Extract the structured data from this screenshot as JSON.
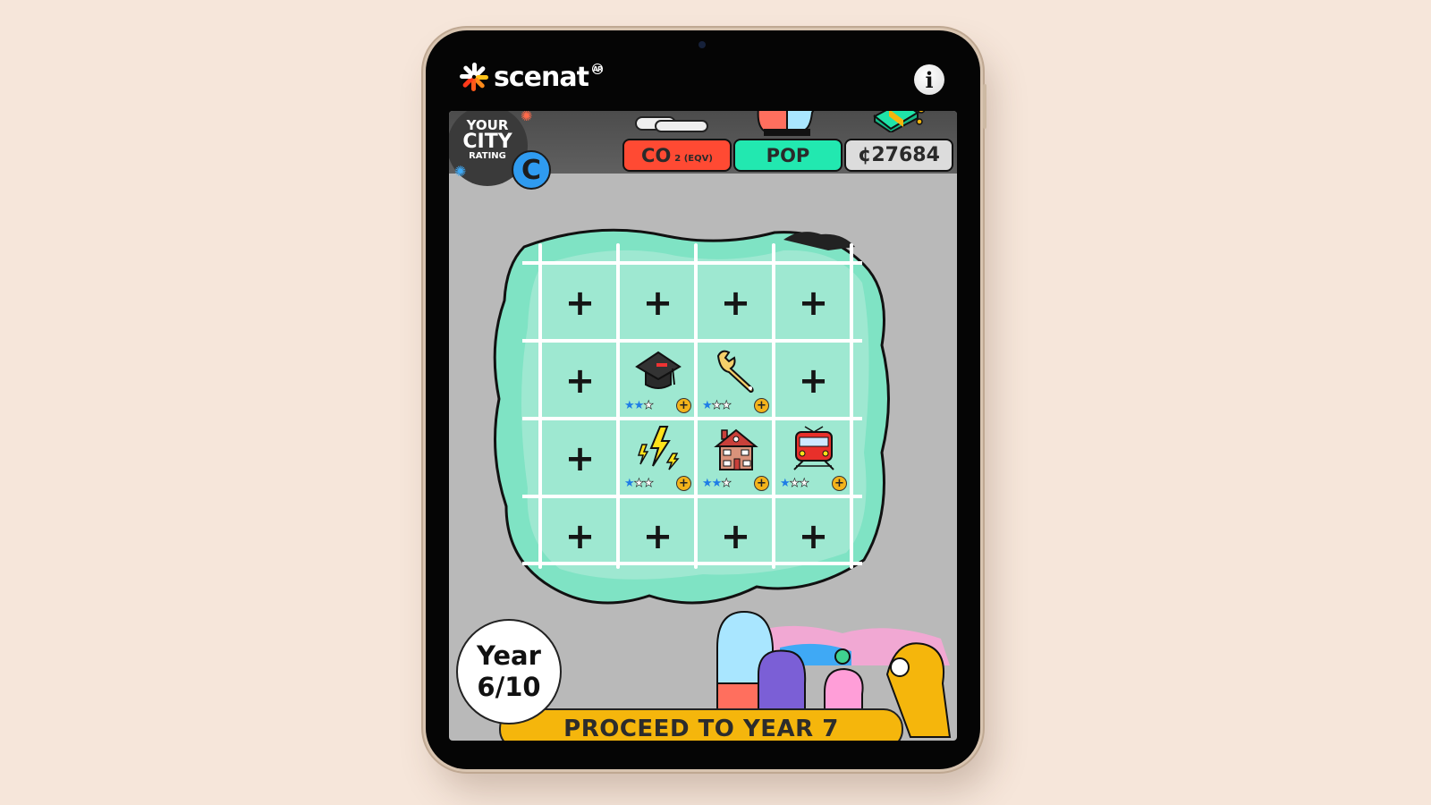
{
  "app": {
    "logo_text": "scenat",
    "logo_badge": "AR",
    "info_label": "i"
  },
  "rating": {
    "line1": "YOUR",
    "line2": "CITY",
    "line3": "RATING",
    "grade": "C"
  },
  "stats": {
    "co2_label": "CO",
    "co2_sub": "2 (EQV)",
    "pop_label": "POP",
    "money": "¢27684"
  },
  "grid": {
    "rows": 4,
    "cols": 4,
    "cells": [
      {
        "type": "empty",
        "label": "+"
      },
      {
        "type": "empty",
        "label": "+"
      },
      {
        "type": "empty",
        "label": "+"
      },
      {
        "type": "empty",
        "label": "+"
      },
      {
        "type": "empty",
        "label": "+"
      },
      {
        "type": "building",
        "icon": "graduation-cap-icon",
        "name": "education",
        "stars": 2,
        "max_stars": 3
      },
      {
        "type": "building",
        "icon": "wrench-icon",
        "name": "maintenance",
        "stars": 1,
        "max_stars": 3
      },
      {
        "type": "empty",
        "label": "+"
      },
      {
        "type": "empty",
        "label": "+"
      },
      {
        "type": "building",
        "icon": "lightning-icon",
        "name": "energy",
        "stars": 1,
        "max_stars": 3
      },
      {
        "type": "building",
        "icon": "house-icon",
        "name": "housing",
        "stars": 2,
        "max_stars": 3
      },
      {
        "type": "building",
        "icon": "train-icon",
        "name": "transport",
        "stars": 1,
        "max_stars": 3
      },
      {
        "type": "empty",
        "label": "+"
      },
      {
        "type": "empty",
        "label": "+"
      },
      {
        "type": "empty",
        "label": "+"
      },
      {
        "type": "empty",
        "label": "+"
      }
    ],
    "upgrade_label": "+"
  },
  "year": {
    "label": "Year",
    "value": "6/10"
  },
  "proceed_button": "PROCEED TO YEAR 7",
  "colors": {
    "co2": "#ff4a33",
    "pop": "#22e8b0",
    "money": "#dcdcdc",
    "grade": "#2f9bf0",
    "proceed": "#f5b60c",
    "island": "#7fe3c4",
    "star_on": "#1e7ce6"
  }
}
